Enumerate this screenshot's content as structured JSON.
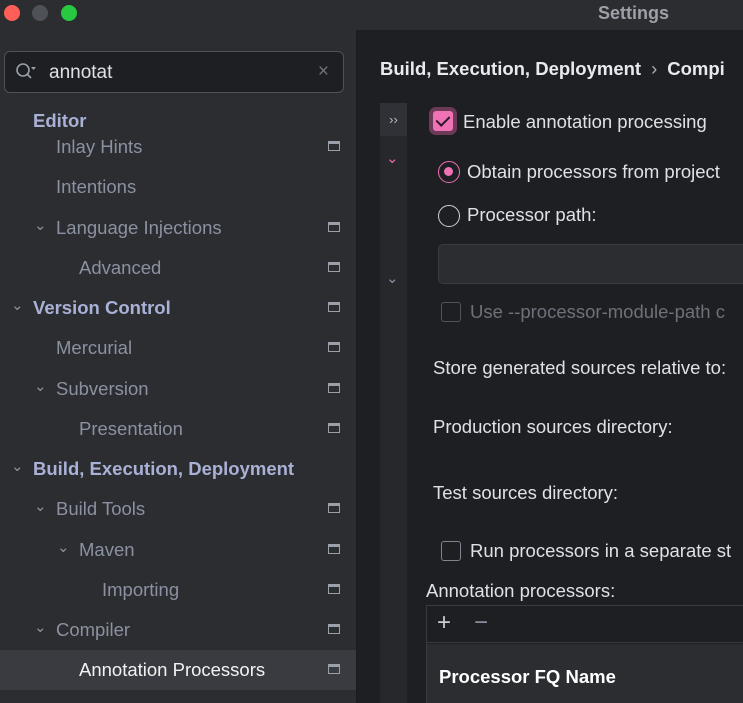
{
  "window": {
    "title": "Settings"
  },
  "search": {
    "value": "annotat",
    "clear_label": "×"
  },
  "sidebar": {
    "items": [
      {
        "label": "Editor"
      },
      {
        "label": "Inlay Hints"
      },
      {
        "label": "Intentions"
      },
      {
        "label": "Language Injections"
      },
      {
        "label": "Advanced"
      },
      {
        "label": "Version Control"
      },
      {
        "label": "Mercurial"
      },
      {
        "label": "Subversion"
      },
      {
        "label": "Presentation"
      },
      {
        "label": "Build, Execution, Deployment"
      },
      {
        "label": "Build Tools"
      },
      {
        "label": "Maven"
      },
      {
        "label": "Importing"
      },
      {
        "label": "Compiler"
      },
      {
        "label": "Annotation Processors"
      }
    ],
    "chevron": "⌄"
  },
  "breadcrumb": {
    "parent": "Build, Execution, Deployment",
    "separator": "›",
    "current": "Compi"
  },
  "gutter": {
    "expand_label": "››",
    "chevron": "⌄"
  },
  "settings": {
    "enable_label": "Enable annotation processing",
    "enable_checked": true,
    "radio_project_label": "Obtain processors from project",
    "radio_path_label": "Processor path:",
    "processor_path_value": "",
    "module_path_label": "Use --processor-module-path c",
    "store_label": "Store generated sources relative to:",
    "production_label": "Production sources directory:",
    "test_label": "Test sources directory:",
    "separate_label": "Run processors in a separate st",
    "annotation_processors_label": "Annotation processors:"
  },
  "table": {
    "add_label": "+",
    "remove_label": "−",
    "column_header": "Processor FQ Name"
  },
  "colors": {
    "accent": "#ef72b4",
    "sidebar_bg": "#2b2d30",
    "main_bg": "#1e1f22",
    "selected_row": "#393b40"
  }
}
